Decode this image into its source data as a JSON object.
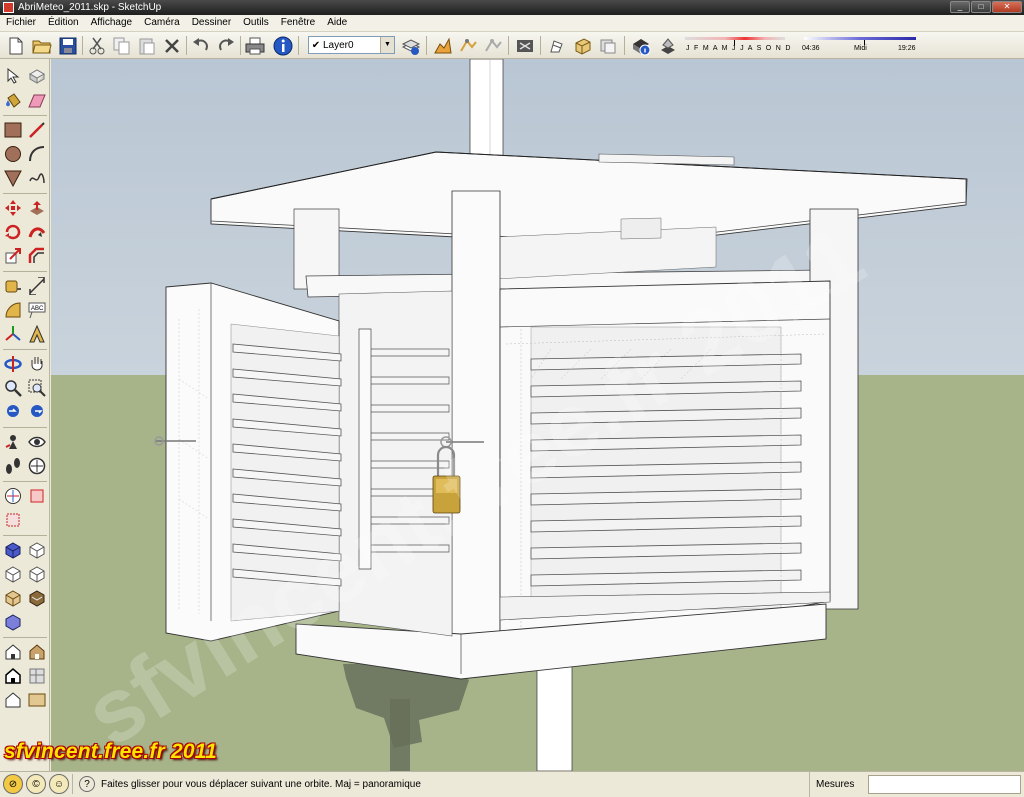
{
  "window": {
    "title": "AbriMeteo_2011.skp - SketchUp"
  },
  "menu": [
    "Fichier",
    "Édition",
    "Affichage",
    "Caméra",
    "Dessiner",
    "Outils",
    "Fenêtre",
    "Aide"
  ],
  "toolbar": {
    "layer_value": "Layer0",
    "icons": [
      "new-icon",
      "open-icon",
      "save-icon",
      "cut-icon",
      "copy-icon",
      "paste-icon",
      "erase-icon",
      "undo-icon",
      "redo-icon",
      "print-icon",
      "model-info-icon"
    ]
  },
  "shadows": {
    "months": "J F M A M J J A S O N D",
    "time_start": "04:36",
    "time_mid": "Midi",
    "time_end": "19:26"
  },
  "status": {
    "hint": "Faites glisser pour vous déplacer suivant une orbite.  Maj = panoramique",
    "measures_label": "Mesures",
    "measures_value": ""
  },
  "watermark": {
    "credit": "sfvincent.free.fr 2011",
    "diagonal": "sfvincent.free.fr 2011"
  },
  "colors": {
    "sky": "#c0cbd6",
    "ground": "#a7b48a",
    "model_white": "#ffffff",
    "credit_yellow": "#ffe400",
    "credit_outline": "#aa0000"
  }
}
